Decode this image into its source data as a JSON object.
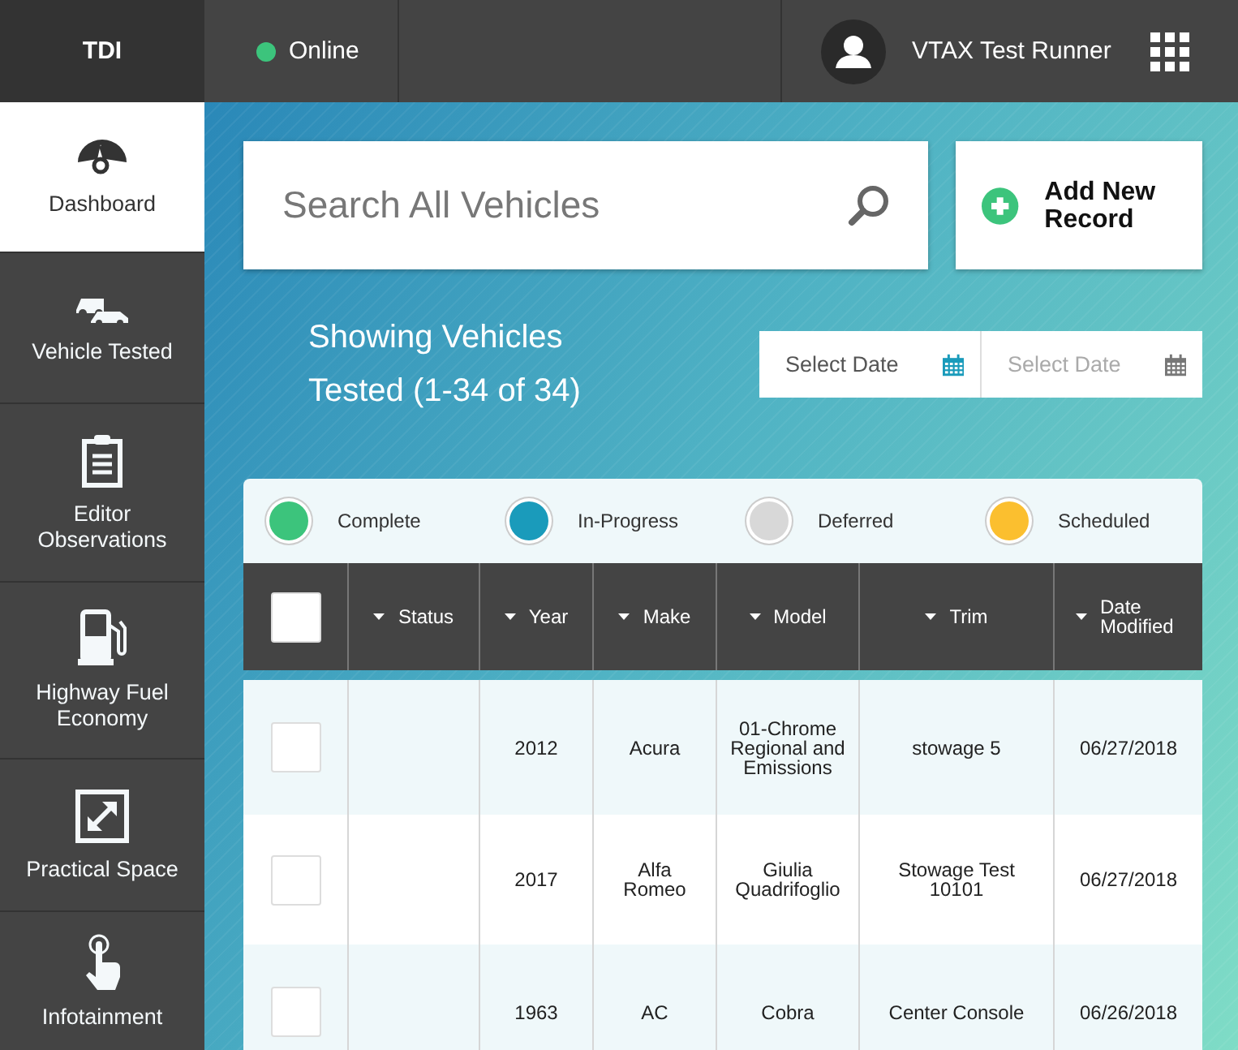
{
  "topbar": {
    "brand": "TDI",
    "status": {
      "label": "Online",
      "connected": true
    },
    "user": {
      "name": "VTAX Test Runner"
    }
  },
  "sidebar": {
    "items": [
      {
        "label": "Dashboard",
        "selected": true
      },
      {
        "label": "Vehicle Tested",
        "selected": false
      },
      {
        "label": "Editor Observations",
        "selected": false
      },
      {
        "label": "Highway Fuel Economy",
        "selected": false
      },
      {
        "label": "Practical Space",
        "selected": false
      },
      {
        "label": "Infotainment",
        "selected": false
      }
    ]
  },
  "search": {
    "placeholder": "Search All Vehicles"
  },
  "add_button": {
    "label": "Add New Record"
  },
  "heading": "Showing Vehicles Tested (1-34 of 34)",
  "date_range": [
    {
      "placeholder": "Select Date",
      "disabled": false
    },
    {
      "placeholder": "Select Date",
      "disabled": true
    }
  ],
  "legend": [
    {
      "label": "Complete",
      "color": "#3cc47c"
    },
    {
      "label": "In-Progress",
      "color": "#1a9bbb"
    },
    {
      "label": "Deferred",
      "color": "#d8d8d8"
    },
    {
      "label": "Scheduled",
      "color": "#fbbf2f"
    }
  ],
  "table": {
    "select_all": {
      "checked": false
    },
    "columns": [
      "Status",
      "Year",
      "Make",
      "Model",
      "Trim",
      "Date Modified"
    ],
    "rows": [
      {
        "checked": false,
        "cells": [
          "",
          "2012",
          "Acura",
          "01-Chrome Regional and Emissions",
          "stowage 5",
          "06/27/2018"
        ]
      },
      {
        "checked": false,
        "cells": [
          "",
          "2017",
          "Alfa Romeo",
          "Giulia Quadrifoglio",
          "Stowage Test 10101",
          "06/27/2018"
        ]
      },
      {
        "checked": false,
        "cells": [
          "",
          "1963",
          "AC",
          "Cobra",
          "Center Console",
          "06/26/2018"
        ]
      }
    ]
  }
}
